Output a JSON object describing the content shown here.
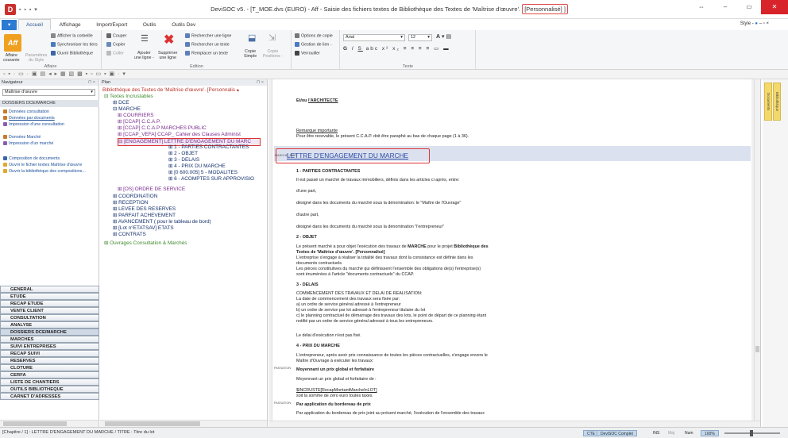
{
  "window": {
    "title": "DeviSOC v5.",
    "title_file": "- [T_MOE.dvs (EURO) - Aff - Saisie des fichiers textes de Bibliothèque des Textes  de 'Maîtrise d'œuvre'.",
    "title_hl": "[Personnalisé] ]"
  },
  "tabs": [
    "Accueil",
    "Affichage",
    "Import/Export",
    "Outils",
    "Outils Dev"
  ],
  "style_label": "Style -",
  "ribbon": {
    "affaire": {
      "big_label": "Aff",
      "line1": "Affaire",
      "line1b": "courante",
      "line2": "Paramètres",
      "line2b": "du Style",
      "afficher": "Afficher la corbeille",
      "sync": "Synchroniser les tiers",
      "ouvrir": "Ouvrir Bibliothèque",
      "group": "Affaire"
    },
    "edition": {
      "couper": "Couper",
      "copier": "Copier",
      "coller": "Coller",
      "ajouter": "Ajouter",
      "ajouter2": "une ligne -",
      "supprimer": "Supprimer",
      "supprimer2": "une ligne",
      "rech_ligne": "Rechercher une ligne",
      "rech_texte": "Rechercher un texte",
      "remplacer": "Remplacer un texte",
      "copie_simple": "Copie",
      "copie_simple2": "Simple",
      "copie_pos": "Copie",
      "copie_pos2": "Positions -",
      "group": "Edition"
    },
    "options": {
      "options": "Options de copie",
      "gestion": "Gestion de lien -",
      "verrouiller": "Verrouiller"
    },
    "texte": {
      "font": "Arial",
      "size": "12",
      "group": "Texte"
    }
  },
  "nav": {
    "title": "Navigateur",
    "select": "Maîtrise d'œuvre",
    "section": "DOSSIERS DCE/MARCHE",
    "links": [
      "Données consultation",
      "Données par documents",
      "Impression d'une consultation",
      "Données Marché",
      "Impression d'un marché",
      "Composition de documents",
      "Ouvrir le fichier textes Maîtrise d'œuvre",
      "Ouvrir la bibliothèque des compositions..."
    ],
    "modules": [
      "GENERAL",
      "ETUDE",
      "RECAP ETUDE",
      "VENTE CLIENT",
      "CONSULTATION",
      "ANALYSE",
      "DOSSIERS DCE/MARCHE",
      "MARCHES",
      "SUIVI ENTREPRISES",
      "RECAP SUIVI",
      "RESERVES",
      "CLOTURE",
      "CERFA",
      "LISTE DE CHANTIERS",
      "OUTILS BIBLIOTHEQUE",
      "CARNET D'ADRESSES"
    ]
  },
  "plan": {
    "title": "Plan",
    "tree": [
      "Bibliothèque des Textes  de 'Maîtrise d'œuvre'. [Personnalis",
      "Textes Incrustables",
      "DCE",
      "MARCHE",
      "COURRIERS",
      "[CCAP] C.C.A.P.",
      "[CCAP] C.C.A.P MARCHES PUBLIC",
      "[CCAP_VEFA] CCAP_ Cahier des Clauses Administ",
      "[ENGAGEMENT] LETTRE D'ENGAGEMENT DU MARC",
      "1 - PARTIES CONTRACTANTES",
      "2 - OBJET",
      "3 - DELAIS",
      "4 - PRIX DU MARCHE",
      "[0 600.005] 5 - MODALITES",
      "6 - ACOMPTES SUR APPROVISIO",
      "[OS] ORDRE DE SERVICE",
      "COORDINATION",
      "RECEPTION",
      "LEVEE DES RESERVES",
      "PARFAIT ACHEVEMENT",
      "AVANCEMENT ( pour le tableau de bord)",
      "[Lot n°ETATSAV] ETATS",
      "CONTRATS",
      "Ouvrages Consultation & Marchés"
    ]
  },
  "doc": {
    "etmou": "Et/ou",
    "architecte": "l'ARCHITECTE",
    "remarque": "Remarque importante",
    "remarque_txt": "Pour être recevable, le présent C.C.A.P. doit être paraphé au bas de chaque page (1 à 36).",
    "banner_marker": "MARCHE_ENG",
    "banner": "LETTRE D'ENGAGEMENT DU MARCHE",
    "h1": "1 - PARTIES CONTRACTANTES",
    "p1": "Il est passé un marché de travaux immobiliers, définis dans les articles ci après, entre:",
    "p2": "d'une part,",
    "p3": "désigné dans les documents du marché sous la dénomination: le \"Maître de l'Ouvrage\"",
    "p4": "d'autre part,",
    "p5": "désigné dans les documents du marché sous la dénomination \"l'entrepreneur\"",
    "h2": "2 - OBJET",
    "p6a": "Le présent marché a pour objet l'exécution des travaux de",
    "p6b": "MARCHE",
    "p6c": "pour le projet",
    "p6d": "Bibliothèque des",
    "p7": "Textes  de 'Maîtrise d'œuvre'. [Personnalisé]",
    "p8": "L'entreprise s'engage à réaliser la totalité des travaux dont la consistance est définie dans les",
    "p9": "documents contractuels.",
    "p10": "Les pièces constitutives du marché qui définissent l'ensemble des obligations de(s) l'entreprise(s)",
    "p11": "sont énumérées à l'article \"documents contractuels\" du CCAP.",
    "h3": "3 - DELAIS",
    "p12": "COMMENCEMENT DES TRAVAUX ET DELAI DE REALISATION:",
    "p13": "La date de commencement des travaux sera fixée par:",
    "p14": "a) un ordre de service général adressé à l'entrepreneur",
    "p15": "b) un ordre de service par lot adressé à l'entrepreneur titulaire du lot",
    "p16": "c) le planning contractuel de démarrage des travaux des lots, le point de départ de ce planning étant",
    "p17": "notifié par un ordre de service général adressé à tous les entrepreneurs.",
    "p18": "Le délai d'exécution n'est pas fixé.",
    "h4": "4 - PRIX DU MARCHE",
    "p19": "L'entrepreneur, après avoir pris connaissance de toutes les pièces contractuelles, s'engage envers le",
    "p20": "Maître d'Ouvrage à exécuter les travaux:",
    "m1": "PASSATION",
    "p21": "Moyennant un prix global et forfaitaire",
    "p22": "Moyennant un prix global et forfaitaire de :",
    "p23": "$INCRUSTE[RecapMontantMarcheInLOT]",
    "p24": "soit la somme de zéro euro toutes taxes",
    "m2": "PASSATION",
    "p25": "Par application du bordereau de prix",
    "p26": "Par application du bordereau de prix joint au présent marché, l'exécution de l'ensemble des travaux"
  },
  "sidetabs": [
    "Bibliothèque",
    "Documents"
  ],
  "status": {
    "text": "[Chapitre / 1] : LETTRE D'ENGAGEMENT DU MARCHE / TITRE : Titre du lot",
    "items": [
      "CTE",
      "DeviSOC Complet",
      "",
      "INS",
      "Maj",
      "Num",
      "100%"
    ]
  }
}
